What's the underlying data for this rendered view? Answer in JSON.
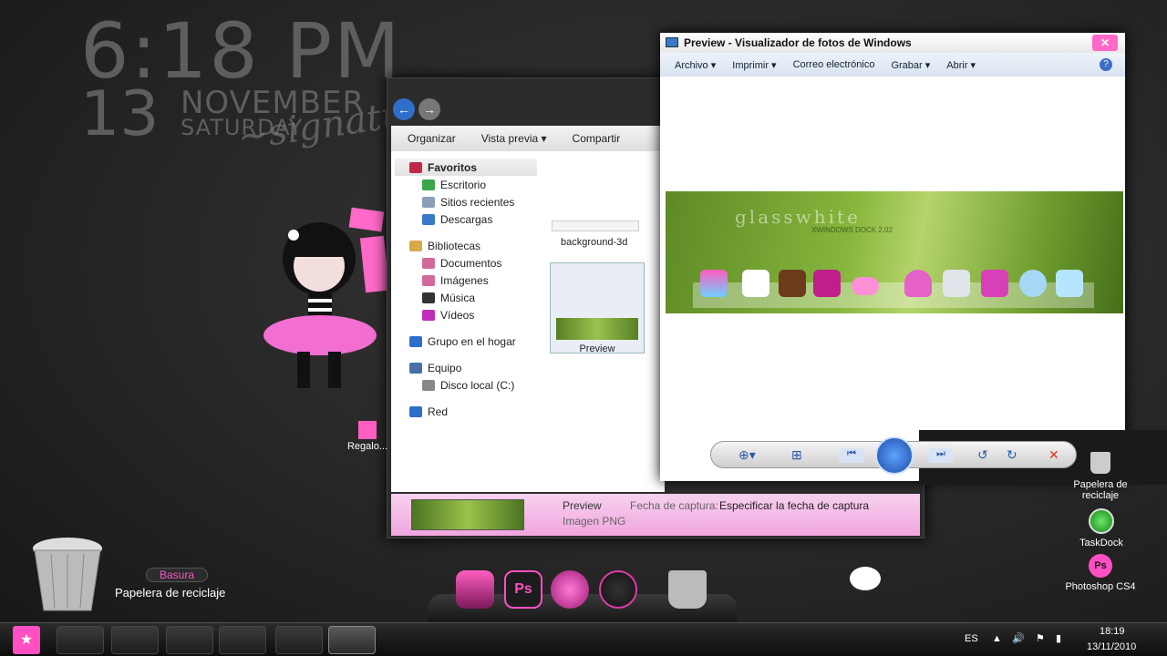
{
  "clock": {
    "time": "6:18 PM",
    "day": "13",
    "month": "NOVEMBER",
    "weekday": "SATURDAY"
  },
  "explorer": {
    "toolbar": {
      "organize": "Organizar",
      "preview": "Vista previa",
      "share": "Compartir"
    },
    "tree": [
      {
        "label": "Favoritos",
        "icon": "star-icon",
        "level": 0
      },
      {
        "label": "Escritorio",
        "icon": "desktop-icon",
        "level": 1
      },
      {
        "label": "Sitios recientes",
        "icon": "recent-icon",
        "level": 1
      },
      {
        "label": "Descargas",
        "icon": "downloads-icon",
        "level": 1
      },
      {
        "label": "Bibliotecas",
        "icon": "library-icon",
        "level": 0
      },
      {
        "label": "Documentos",
        "icon": "documents-icon",
        "level": 1
      },
      {
        "label": "Imágenes",
        "icon": "pictures-icon",
        "level": 1
      },
      {
        "label": "Música",
        "icon": "music-icon",
        "level": 1
      },
      {
        "label": "Vídeos",
        "icon": "videos-icon",
        "level": 1
      },
      {
        "label": "Grupo en el hogar",
        "icon": "homegroup-icon",
        "level": 0
      },
      {
        "label": "Equipo",
        "icon": "computer-icon",
        "level": 0
      },
      {
        "label": "Disco local (C:)",
        "icon": "drive-icon",
        "level": 1
      },
      {
        "label": "Red",
        "icon": "network-icon",
        "level": 0
      }
    ],
    "files": [
      {
        "name": "background-3d"
      },
      {
        "name": "Preview"
      }
    ],
    "details": {
      "name": "Preview",
      "type": "Imagen PNG",
      "date_label": "Fecha de captura:",
      "date_value": "Especificar la fecha de captura"
    }
  },
  "viewer": {
    "title": "Preview - Visualizador de fotos de Windows",
    "menu": [
      "Archivo",
      "Imprimir",
      "Correo electrónico",
      "Grabar",
      "Abrir"
    ],
    "photo_title": "glasswhite",
    "photo_subtitle": "XWINDOWS DOCK 2.02"
  },
  "desktop": {
    "gift_label": "Regalo...",
    "bin_tag": "Basura",
    "bin_label": "Papelera de reciclaje",
    "right_icons": [
      {
        "label": "Papelera de reciclaje"
      },
      {
        "label": "TaskDock"
      },
      {
        "label": "Photoshop CS4"
      }
    ]
  },
  "dock": {
    "ps_label": "Ps"
  },
  "taskbar": {
    "lang": "ES",
    "time": "18:19",
    "date": "13/11/2010"
  },
  "colors": {
    "accent": "#ff4fc3",
    "dark": "#1a1a1a"
  }
}
